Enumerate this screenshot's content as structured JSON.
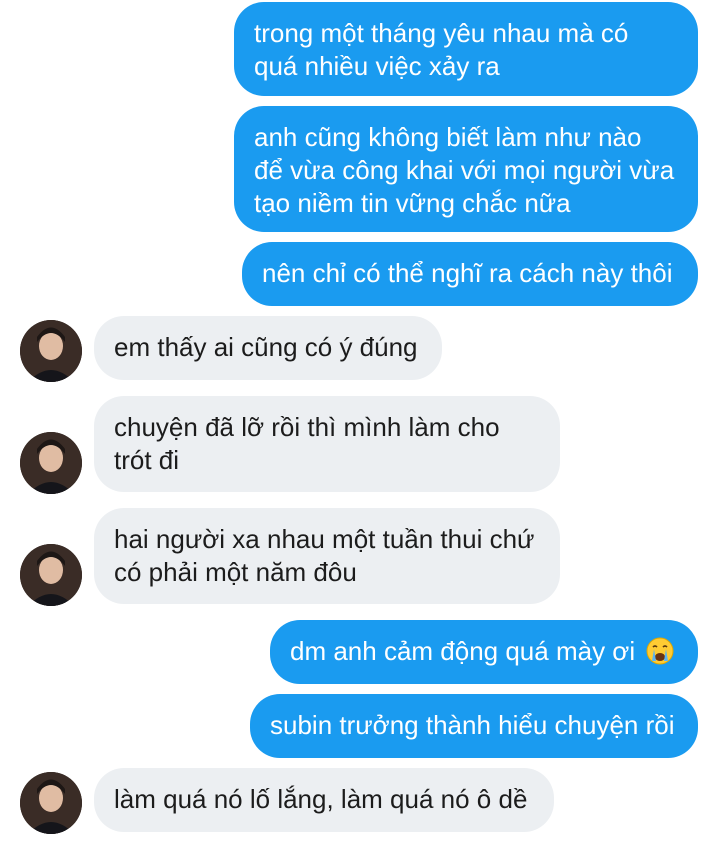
{
  "messages": [
    {
      "side": "out",
      "lines": [
        "trong một tháng yêu nhau mà có",
        "quá nhiều việc xảy ra"
      ]
    },
    {
      "side": "out",
      "lines": [
        "anh cũng không biết làm như nào",
        "để vừa công khai với mọi người vừa",
        "tạo niềm tin vững chắc nữa"
      ]
    },
    {
      "side": "out",
      "lines": [
        "nên chỉ có thể nghĩ ra cách này thôi"
      ]
    },
    {
      "side": "in",
      "lines": [
        "em thấy ai cũng có ý đúng"
      ]
    },
    {
      "side": "in",
      "lines": [
        "chuyện đã lỡ rồi thì mình làm cho",
        "trót đi"
      ]
    },
    {
      "side": "in",
      "lines": [
        "hai người xa nhau một tuần thui chứ",
        "có phải một năm đôu"
      ]
    },
    {
      "side": "out",
      "lines": [
        "dm anh cảm động quá mày ơi"
      ],
      "emoji": "crying-face"
    },
    {
      "side": "out",
      "lines": [
        "subin trưởng thành hiểu chuyện rồi"
      ]
    },
    {
      "side": "in",
      "lines": [
        "làm quá nó lố lắng, làm quá nó ô dề"
      ]
    }
  ],
  "colors": {
    "outgoing_bubble": "#1a9bf0",
    "incoming_bubble": "#eceff2",
    "outgoing_text": "#ffffff",
    "incoming_text": "#1c1c1c"
  }
}
